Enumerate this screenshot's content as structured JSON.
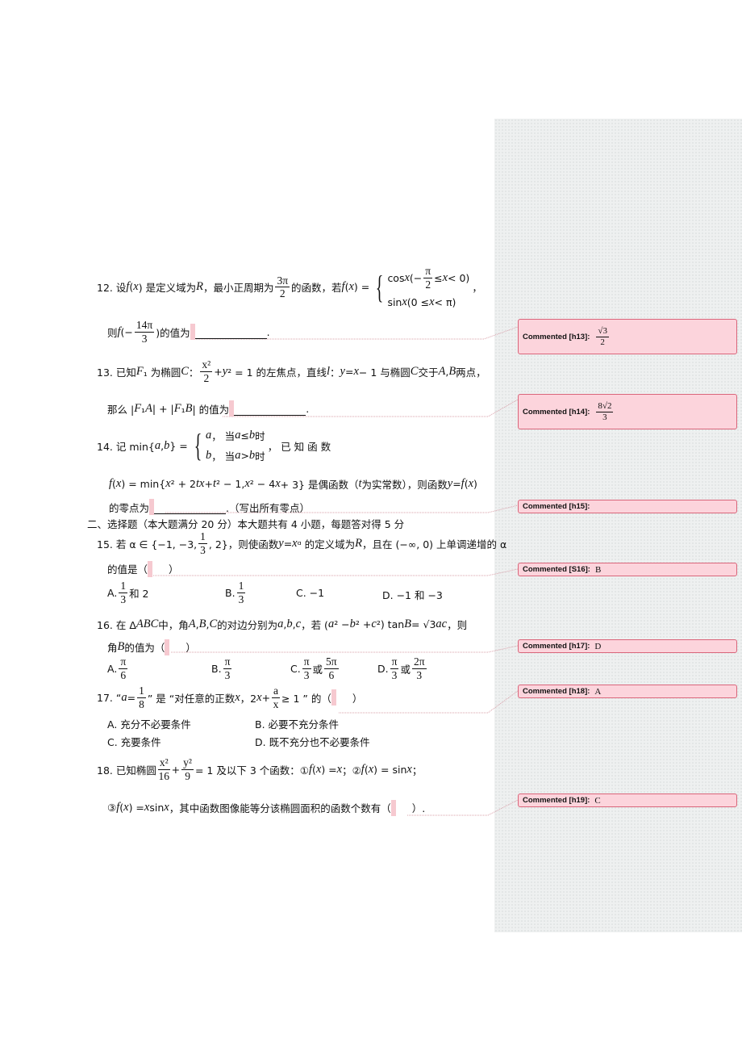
{
  "questions": {
    "q12_l1": [
      {
        "t": "12.  设 "
      },
      {
        "m": "f"
      },
      {
        "t": "("
      },
      {
        "m": "x"
      },
      {
        "t": ") 是定义域为 "
      },
      {
        "m": "R"
      },
      {
        "t": "，最小正周期为"
      },
      {
        "n": "3π",
        "d": "2"
      },
      {
        "t": "的函数，若 "
      },
      {
        "m": "f"
      },
      {
        "t": "("
      },
      {
        "m": "x"
      },
      {
        "t": ") = "
      },
      {
        "cases": [
          [
            {
              "t": "cos "
            },
            {
              "m": "x"
            },
            {
              "t": "    (−"
            },
            {
              "n": "π",
              "d": "2"
            },
            {
              "t": "≤ "
            },
            {
              "m": "x"
            },
            {
              "t": " < 0)"
            }
          ],
          [
            {
              "t": "sin "
            },
            {
              "m": "x"
            },
            {
              "t": "    (0 ≤ "
            },
            {
              "m": "x"
            },
            {
              "t": " < π)"
            }
          ]
        ]
      },
      {
        "t": "，"
      }
    ],
    "q12_l2": [
      {
        "t": "则 "
      },
      {
        "m": "f"
      },
      {
        "t": "(−"
      },
      {
        "n": "14π",
        "d": "3"
      },
      {
        "t": ")的值为"
      },
      {
        "blank": "fill"
      },
      {
        "t": "."
      }
    ],
    "q13_l1": [
      {
        "t": "13. 已知 "
      },
      {
        "m": "F"
      },
      {
        "t": "₁ 为椭圆 "
      },
      {
        "m": "C"
      },
      {
        "t": " ： "
      },
      {
        "n": "x²",
        "d": "2"
      },
      {
        "t": " + "
      },
      {
        "m": "y"
      },
      {
        "t": "² = 1 的左焦点，直线 "
      },
      {
        "m": "l"
      },
      {
        "t": "：  "
      },
      {
        "m": "y"
      },
      {
        "t": " = "
      },
      {
        "m": "x"
      },
      {
        "t": " − 1 与椭圆 "
      },
      {
        "m": "C"
      },
      {
        "t": " 交于 "
      },
      {
        "m": "A"
      },
      {
        "t": ", "
      },
      {
        "m": "B"
      },
      {
        "t": " 两点，"
      }
    ],
    "q13_l2": [
      {
        "t": "那么 | "
      },
      {
        "m": "F"
      },
      {
        "t": "₁"
      },
      {
        "m": "A"
      },
      {
        "t": " | + | "
      },
      {
        "m": "F"
      },
      {
        "t": "₁"
      },
      {
        "m": "B"
      },
      {
        "t": " | 的值为"
      },
      {
        "blank": "fill"
      },
      {
        "t": "."
      }
    ],
    "q14_l1": [
      {
        "t": "14.          记          min{"
      },
      {
        "m": "a"
      },
      {
        "t": " , "
      },
      {
        "m": "b"
      },
      {
        "t": "} = "
      },
      {
        "cases": [
          [
            {
              "m": "a"
            },
            {
              "t": "，  当"
            },
            {
              "m": "a"
            },
            {
              "t": " ≤ "
            },
            {
              "m": "b"
            },
            {
              "t": "时"
            }
          ],
          [
            {
              "m": "b"
            },
            {
              "t": "，  当"
            },
            {
              "m": "a"
            },
            {
              "t": " > "
            },
            {
              "m": "b"
            },
            {
              "t": "时"
            }
          ]
        ]
      },
      {
        "t": "，          已          知          函          数"
      }
    ],
    "q14_l2": [
      {
        "m": "f"
      },
      {
        "t": "("
      },
      {
        "m": "x"
      },
      {
        "t": ") = min{"
      },
      {
        "m": "x"
      },
      {
        "t": "² + 2"
      },
      {
        "m": "tx"
      },
      {
        "t": " + "
      },
      {
        "m": "t"
      },
      {
        "t": "² − 1, "
      },
      {
        "m": "x"
      },
      {
        "t": "² − 4"
      },
      {
        "m": "x"
      },
      {
        "t": " + 3} 是偶函数（"
      },
      {
        "m": "t"
      },
      {
        "t": " 为实常数），则函数 "
      },
      {
        "m": "y"
      },
      {
        "t": " = "
      },
      {
        "m": "f"
      },
      {
        "t": "("
      },
      {
        "m": "x"
      },
      {
        "t": ")"
      }
    ],
    "q14_l3": [
      {
        "t": "的零点为"
      },
      {
        "blank": "fill"
      },
      {
        "t": ".（写出所有零点）"
      }
    ],
    "section2": [
      {
        "t": "二、选择题（本大题满分 20 分）本大题共有 4 小题，每题答对得 5 分"
      }
    ],
    "q15_l1": [
      {
        "t": "15.  若 α ∈ {−1, −3, "
      },
      {
        "n": "1",
        "d": "3"
      },
      {
        "t": ", 2}，则使函数 "
      },
      {
        "m": "y"
      },
      {
        "t": " = "
      },
      {
        "m": "x"
      },
      {
        "t": "ᵅ 的定义域为 "
      },
      {
        "m": "R"
      },
      {
        "t": "，且在 (−∞, 0) 上单调递增的 α"
      }
    ],
    "q15_l2": [
      {
        "t": "的值是（"
      },
      {
        "blank": "paren"
      },
      {
        "t": "）"
      }
    ],
    "q15_opts": [
      [
        {
          "t": "A.  "
        },
        {
          "n": "1",
          "d": "3"
        },
        {
          "t": " 和 2"
        }
      ],
      [
        {
          "t": "B.  "
        },
        {
          "n": "1",
          "d": "3"
        }
      ],
      [
        {
          "t": "C.   −1"
        }
      ],
      [
        {
          "t": "D.   −1 和 −3"
        }
      ]
    ],
    "q16_l1": [
      {
        "t": "16.  在 Δ"
      },
      {
        "m": "ABC"
      },
      {
        "t": " 中，角 "
      },
      {
        "m": "A"
      },
      {
        "t": ", "
      },
      {
        "m": "B"
      },
      {
        "t": ", "
      },
      {
        "m": "C"
      },
      {
        "t": " 的对边分别为 "
      },
      {
        "m": "a"
      },
      {
        "t": ", "
      },
      {
        "m": "b"
      },
      {
        "t": ", "
      },
      {
        "m": "c"
      },
      {
        "t": "，若 ("
      },
      {
        "m": "a"
      },
      {
        "t": "² − "
      },
      {
        "m": "b"
      },
      {
        "t": "² + "
      },
      {
        "m": "c"
      },
      {
        "t": "²) tan "
      },
      {
        "m": "B"
      },
      {
        "t": " = √3"
      },
      {
        "m": "ac"
      },
      {
        "t": "，则"
      }
    ],
    "q16_l2": [
      {
        "t": "角 "
      },
      {
        "m": "B"
      },
      {
        "t": " 的值为（"
      },
      {
        "blank": "paren"
      },
      {
        "t": "）"
      }
    ],
    "q16_opts": [
      [
        {
          "t": "A.  "
        },
        {
          "n": "π",
          "d": "6"
        }
      ],
      [
        {
          "t": "B.  "
        },
        {
          "n": "π",
          "d": "3"
        }
      ],
      [
        {
          "t": "C.  "
        },
        {
          "n": "π",
          "d": "3"
        },
        {
          "t": "或"
        },
        {
          "n": "5π",
          "d": "6"
        }
      ],
      [
        {
          "t": "D.  "
        },
        {
          "n": "π",
          "d": "3"
        },
        {
          "t": "或"
        },
        {
          "n": "2π",
          "d": "3"
        }
      ]
    ],
    "q17_l1": [
      {
        "t": "17.   “"
      },
      {
        "m": "a"
      },
      {
        "t": " = "
      },
      {
        "n": "1",
        "d": "8"
      },
      {
        "t": "” 是 “对任意的正数 "
      },
      {
        "m": "x"
      },
      {
        "t": "，2"
      },
      {
        "m": "x"
      },
      {
        "t": " + "
      },
      {
        "n": "a",
        "d": "x"
      },
      {
        "t": "≥ 1 ” 的（"
      },
      {
        "blank": "paren"
      },
      {
        "t": "）"
      }
    ],
    "q17_opts": [
      [
        {
          "t": "A.  充分不必要条件"
        }
      ],
      [
        {
          "t": "B.  必要不充分条件"
        }
      ],
      [
        {
          "t": "C.  充要条件"
        }
      ],
      [
        {
          "t": "D.  既不充分也不必要条件"
        }
      ]
    ],
    "q18_l1": [
      {
        "t": "18.  已知椭圆 "
      },
      {
        "n": "x²",
        "d": "16"
      },
      {
        "t": " + "
      },
      {
        "n": "y²",
        "d": "9"
      },
      {
        "t": " = 1 及以下 3 个函数：① "
      },
      {
        "m": "f"
      },
      {
        "t": "("
      },
      {
        "m": "x"
      },
      {
        "t": ") = "
      },
      {
        "m": "x"
      },
      {
        "t": "；② "
      },
      {
        "m": "f"
      },
      {
        "t": "("
      },
      {
        "m": "x"
      },
      {
        "t": ") = sin "
      },
      {
        "m": "x"
      },
      {
        "t": "；"
      }
    ],
    "q18_l2": [
      {
        "t": "③ "
      },
      {
        "m": "f"
      },
      {
        "t": "("
      },
      {
        "m": "x"
      },
      {
        "t": ") = "
      },
      {
        "m": "x"
      },
      {
        "t": " sin "
      },
      {
        "m": "x"
      },
      {
        "t": "，其中函数图像能等分该椭圆面积的函数个数有（"
      },
      {
        "blank": "paren"
      },
      {
        "t": "）."
      }
    ]
  },
  "comments": [
    {
      "label": "Commented [h13]:",
      "text": "",
      "frac": {
        "n": "√3",
        "d": "2"
      }
    },
    {
      "label": "Commented [h14]:",
      "text": "",
      "frac": {
        "n": "8√2",
        "d": "3"
      }
    },
    {
      "label": "Commented [h15]:",
      "text": ""
    },
    {
      "label": "Commented [S16]:",
      "text": "B"
    },
    {
      "label": "Commented [h17]:",
      "text": "D"
    },
    {
      "label": "Commented [h18]:",
      "text": "A"
    },
    {
      "label": "Commented [h19]:",
      "text": "C"
    }
  ],
  "colors": {
    "comment_fill": "#fcd4dc",
    "comment_border": "#d9657a",
    "sidebar": "#eef0f0"
  }
}
